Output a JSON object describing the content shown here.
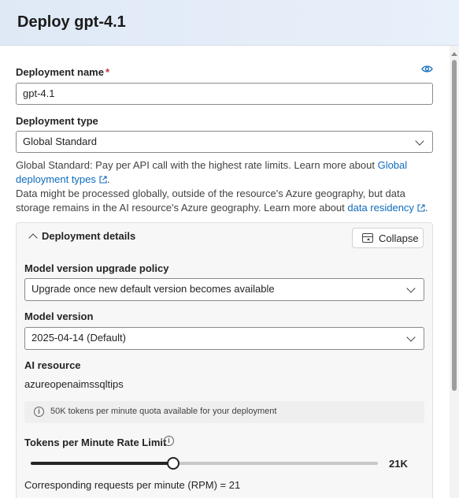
{
  "dialog": {
    "title": "Deploy gpt-4.1"
  },
  "deployment_name": {
    "label": "Deployment name",
    "required_mark": "*",
    "value": "gpt-4.1"
  },
  "deployment_type": {
    "label": "Deployment type",
    "selected": "Global Standard",
    "help_line1_prefix": "Global Standard: Pay per API call with the highest rate limits. Learn more about ",
    "help_link1": "Global deployment types",
    "help_line1_suffix": ".",
    "help_line2_prefix": "Data might be processed globally, outside of the resource's Azure geography, but data storage remains in the AI resource's Azure geography. Learn more about ",
    "help_link2": "data residency",
    "help_line2_suffix": "."
  },
  "details": {
    "title": "Deployment details",
    "collapse_label": "Collapse",
    "upgrade_policy": {
      "label": "Model version upgrade policy",
      "selected": "Upgrade once new default version becomes available"
    },
    "model_version": {
      "label": "Model version",
      "selected": "2025-04-14 (Default)"
    },
    "ai_resource": {
      "label": "AI resource",
      "value": "azureopenaimssqltips"
    },
    "quota_banner": "50K tokens per minute quota available for your deployment",
    "tpm": {
      "label": "Tokens per Minute Rate Limit",
      "value_label": "21K",
      "fraction": 0.41
    },
    "rpm_text": "Corresponding requests per minute (RPM) = 21"
  },
  "icons": {
    "eye": "eye-icon",
    "info": "info-icon",
    "external": "external-link-icon",
    "chevron": "chevron-down-icon",
    "collapse": "collapse-icon"
  },
  "colors": {
    "link": "#0f6cbd",
    "required": "#c4314b",
    "header_bg": "#e3ecf7"
  }
}
